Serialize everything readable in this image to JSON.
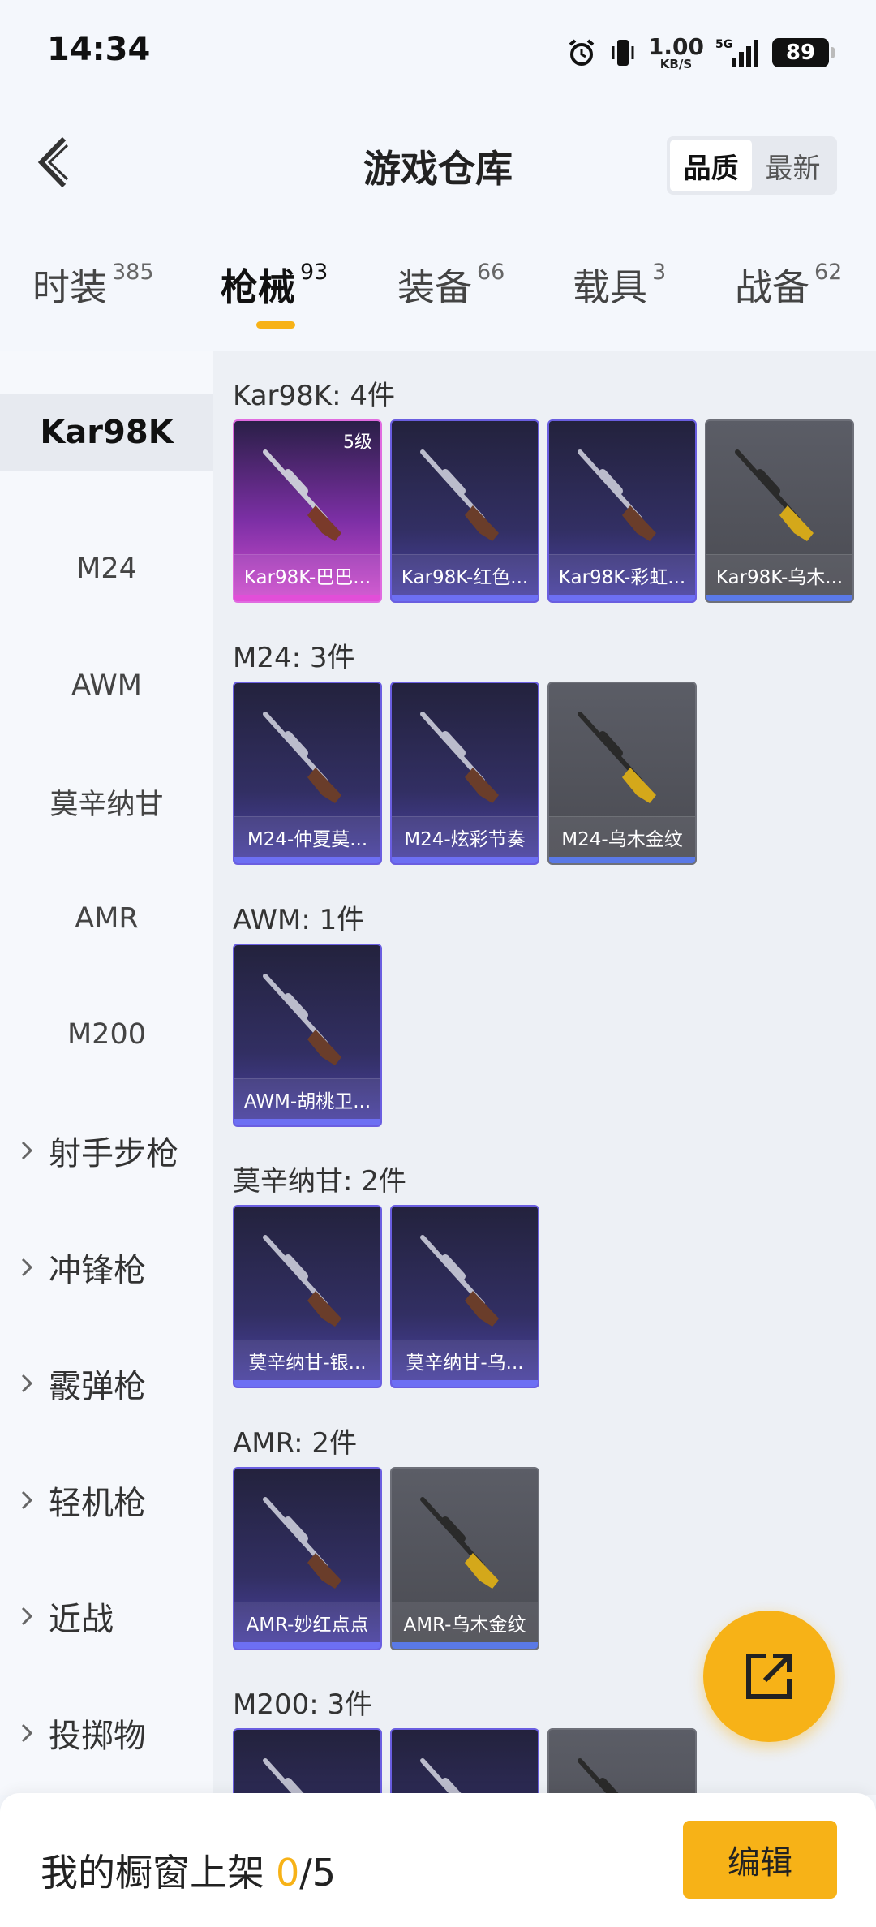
{
  "status_bar": {
    "time": "14:34",
    "net_speed": "1.00",
    "net_unit": "KB/S",
    "network": "5G",
    "battery": "89"
  },
  "header": {
    "title": "游戏仓库",
    "sort_options": [
      "品质",
      "最新"
    ],
    "sort_selected": "品质"
  },
  "tabs": [
    {
      "label": "时装",
      "count": "385"
    },
    {
      "label": "枪械",
      "count": "93"
    },
    {
      "label": "装备",
      "count": "66"
    },
    {
      "label": "载具",
      "count": "3"
    },
    {
      "label": "战备",
      "count": "62"
    }
  ],
  "active_tab": "枪械",
  "sidebar": {
    "weapons": [
      "Kar98K",
      "M24",
      "AWM",
      "莫辛纳甘",
      "AMR",
      "M200"
    ],
    "active": "Kar98K",
    "categories": [
      "射手步枪",
      "冲锋枪",
      "霰弹枪",
      "轻机枪",
      "近战",
      "投掷物"
    ]
  },
  "sections": [
    {
      "title": "Kar98K: 4件",
      "items": [
        {
          "name": "Kar98K-巴巴...",
          "rarity": "pink",
          "level": "5级"
        },
        {
          "name": "Kar98K-红色...",
          "rarity": "purple"
        },
        {
          "name": "Kar98K-彩虹...",
          "rarity": "purple"
        },
        {
          "name": "Kar98K-乌木...",
          "rarity": "gray"
        }
      ]
    },
    {
      "title": "M24: 3件",
      "items": [
        {
          "name": "M24-仲夏莫...",
          "rarity": "purple"
        },
        {
          "name": "M24-炫彩节奏",
          "rarity": "purple"
        },
        {
          "name": "M24-乌木金纹",
          "rarity": "gray"
        }
      ]
    },
    {
      "title": "AWM: 1件",
      "items": [
        {
          "name": "AWM-胡桃卫...",
          "rarity": "purple"
        }
      ]
    },
    {
      "title": "莫辛纳甘: 2件",
      "items": [
        {
          "name": "莫辛纳甘-银...",
          "rarity": "purple"
        },
        {
          "name": "莫辛纳甘-乌...",
          "rarity": "purple"
        }
      ]
    },
    {
      "title": "AMR: 2件",
      "items": [
        {
          "name": "AMR-妙红点点",
          "rarity": "purple"
        },
        {
          "name": "AMR-乌木金纹",
          "rarity": "gray"
        }
      ]
    },
    {
      "title": "M200: 3件",
      "items": [
        {
          "name": "",
          "rarity": "purple"
        },
        {
          "name": "",
          "rarity": "purple"
        },
        {
          "name": "",
          "rarity": "gray"
        }
      ]
    }
  ],
  "showcase": {
    "label": "我的橱窗上架",
    "count": "0",
    "total": "/5"
  },
  "edit_button": "编辑",
  "colors": {
    "accent": "#f7b217",
    "rarity_purple": "#6a5ee0",
    "rarity_pink": "#e06be0",
    "rarity_gray": "#6e7079"
  },
  "icons": {
    "back": "chevron-left-icon",
    "share": "share-external-icon",
    "alarm": "alarm-icon",
    "vibrate": "vibrate-icon",
    "signal": "signal-icon"
  }
}
